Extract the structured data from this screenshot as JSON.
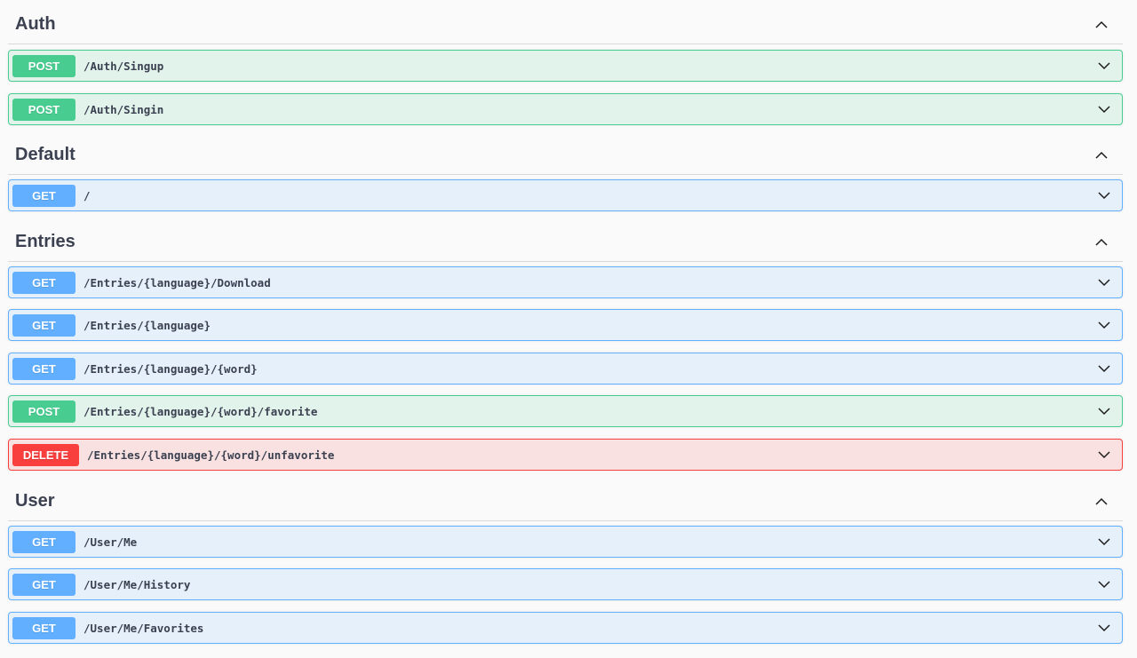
{
  "sections": {
    "auth": {
      "title": "Auth",
      "ops": [
        {
          "method": "POST",
          "path": "/Auth/Singup"
        },
        {
          "method": "POST",
          "path": "/Auth/Singin"
        }
      ]
    },
    "default": {
      "title": "Default",
      "ops": [
        {
          "method": "GET",
          "path": "/"
        }
      ]
    },
    "entries": {
      "title": "Entries",
      "ops": [
        {
          "method": "GET",
          "path": "/Entries/{language}/Download"
        },
        {
          "method": "GET",
          "path": "/Entries/{language}"
        },
        {
          "method": "GET",
          "path": "/Entries/{language}/{word}"
        },
        {
          "method": "POST",
          "path": "/Entries/{language}/{word}/favorite"
        },
        {
          "method": "DELETE",
          "path": "/Entries/{language}/{word}/unfavorite"
        }
      ]
    },
    "user": {
      "title": "User",
      "ops": [
        {
          "method": "GET",
          "path": "/User/Me"
        },
        {
          "method": "GET",
          "path": "/User/Me/History"
        },
        {
          "method": "GET",
          "path": "/User/Me/Favorites"
        }
      ]
    }
  },
  "icons": {
    "collapse": "chevron-up-icon",
    "expand": "chevron-down-icon"
  },
  "colors": {
    "post": "#49cc90",
    "get": "#61affe",
    "delete": "#f93e3e",
    "text": "#3b4151"
  }
}
